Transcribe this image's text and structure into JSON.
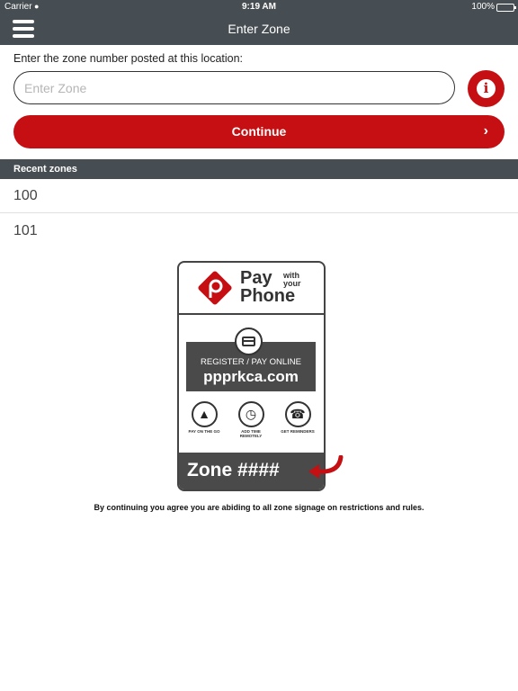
{
  "status_bar": {
    "carrier": "Carrier",
    "time": "9:19 AM",
    "battery": "100%"
  },
  "nav": {
    "title": "Enter Zone"
  },
  "form": {
    "prompt": "Enter the zone number posted at this location:",
    "zone_input_placeholder": "Enter Zone",
    "zone_input_value": "",
    "continue_label": "Continue"
  },
  "recent": {
    "header": "Recent zones",
    "items": [
      "100",
      "101"
    ]
  },
  "sign": {
    "brand_pay": "Pay",
    "brand_with_your": "with your",
    "brand_phone": "Phone",
    "register_label": "REGISTER / PAY ONLINE",
    "url": "ppprkca.com",
    "features": [
      "PAY ON THE GO",
      "ADD TIME REMOTELY",
      "GET REMINDERS"
    ],
    "zone_text": "Zone ####"
  },
  "footer": {
    "note": "By continuing you agree you are abiding to all zone signage on restrictions and rules."
  },
  "colors": {
    "bar": "#474e53",
    "accent_red": "#c60f12"
  },
  "icons": {
    "menu": "hamburger-icon",
    "info": "info-icon",
    "continue": "chevron-right-icon",
    "wifi": "wifi-icon"
  }
}
